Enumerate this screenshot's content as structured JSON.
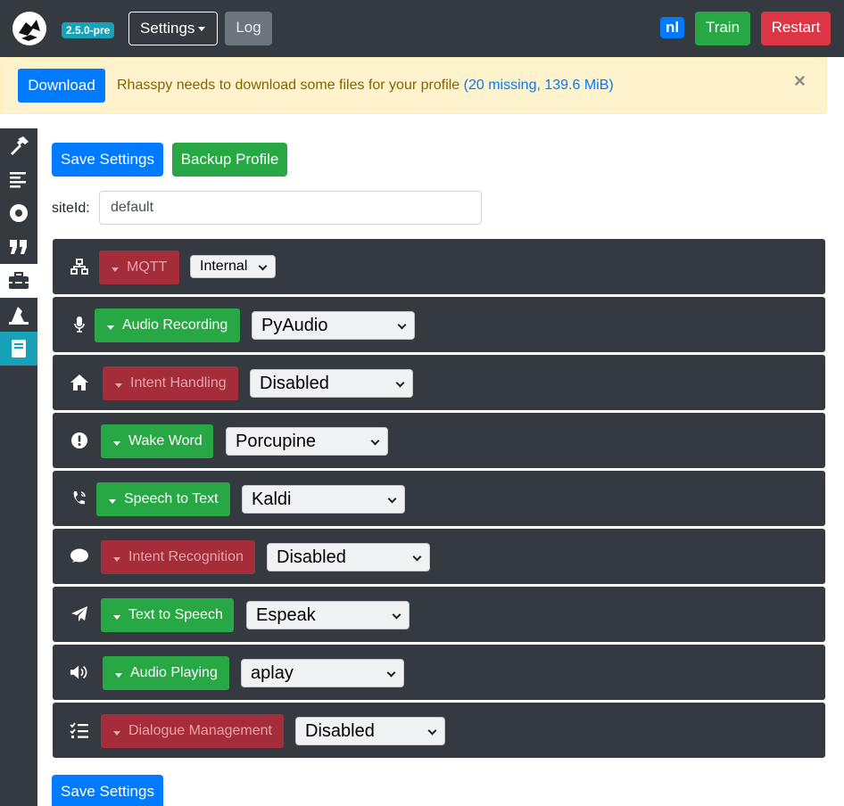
{
  "navbar": {
    "version": "2.5.0-pre",
    "settings_label": "Settings",
    "log_label": "Log",
    "language": "nl",
    "train_label": "Train",
    "restart_label": "Restart"
  },
  "alert": {
    "download_label": "Download",
    "message": "Rhasspy needs to download some files for your profile",
    "missing": "(20 missing, 139.6 MiB)",
    "close": "×"
  },
  "sidebar": {
    "items": [
      "hammer-icon",
      "align-left-icon",
      "record-icon",
      "quote-icon",
      "toolbox-icon",
      "wizard-hat-icon",
      "book-icon"
    ]
  },
  "main": {
    "save_label": "Save Settings",
    "backup_label": "Backup Profile",
    "siteid_label": "siteId:",
    "siteid_value": "default"
  },
  "services": [
    {
      "icon": "network-icon",
      "label": "MQTT",
      "enabled": false,
      "value": "Internal"
    },
    {
      "icon": "microphone-icon",
      "label": "Audio Recording",
      "enabled": true,
      "value": "PyAudio"
    },
    {
      "icon": "home-icon",
      "label": "Intent Handling",
      "enabled": false,
      "value": "Disabled"
    },
    {
      "icon": "exclamation-circle-icon",
      "label": "Wake Word",
      "enabled": true,
      "value": "Porcupine"
    },
    {
      "icon": "phone-volume-icon",
      "label": "Speech to Text",
      "enabled": true,
      "value": "Kaldi"
    },
    {
      "icon": "comment-icon",
      "label": "Intent Recognition",
      "enabled": false,
      "value": "Disabled"
    },
    {
      "icon": "paper-plane-icon",
      "label": "Text to Speech",
      "enabled": true,
      "value": "Espeak"
    },
    {
      "icon": "volume-up-icon",
      "label": "Audio Playing",
      "enabled": true,
      "value": "aplay"
    },
    {
      "icon": "tasks-icon",
      "label": "Dialogue Management",
      "enabled": false,
      "value": "Disabled"
    }
  ],
  "colors": {
    "primary": "#007bff",
    "success": "#28a745",
    "danger": "#dc3545",
    "dark": "#343a40",
    "info": "#17a2b8",
    "warning_bg": "#fff3cd"
  }
}
